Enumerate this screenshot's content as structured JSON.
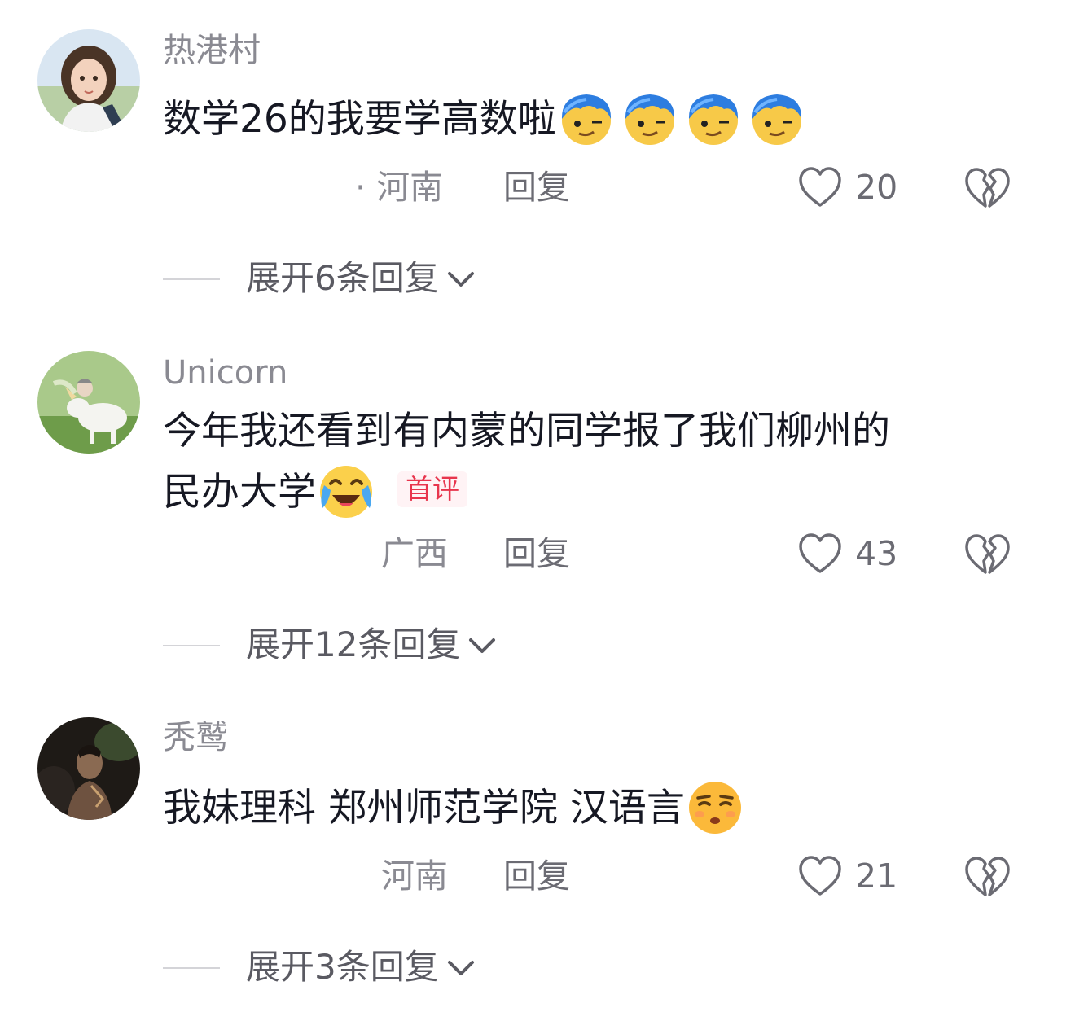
{
  "comments": [
    {
      "username": "热港村",
      "text": "数学26的我要学高数啦",
      "emoji_count": 4,
      "emoji_name": "blue-hair-smirk-emoji",
      "location": "· 河南",
      "reply_label": "回复",
      "likes": "20",
      "expand_label": "展开6条回复"
    },
    {
      "username": "Unicorn",
      "text_line1": "今年我还看到有内蒙的同学报了我们柳州的",
      "text_line2": "民办大学",
      "emoji_name": "laugh-cry-emoji",
      "badge": "首评",
      "location": "广西",
      "reply_label": "回复",
      "likes": "43",
      "expand_label": "展开12条回复"
    },
    {
      "username": "秃鹫",
      "text": "我妹理科 郑州师范学院 汉语言",
      "emoji_name": "smug-face-emoji",
      "location": "河南",
      "reply_label": "回复",
      "likes": "21",
      "expand_label": "展开3条回复"
    }
  ],
  "colors": {
    "username": "#8a8a92",
    "text": "#161823",
    "badge": "#e8354d",
    "meta": "#8a8a92"
  }
}
